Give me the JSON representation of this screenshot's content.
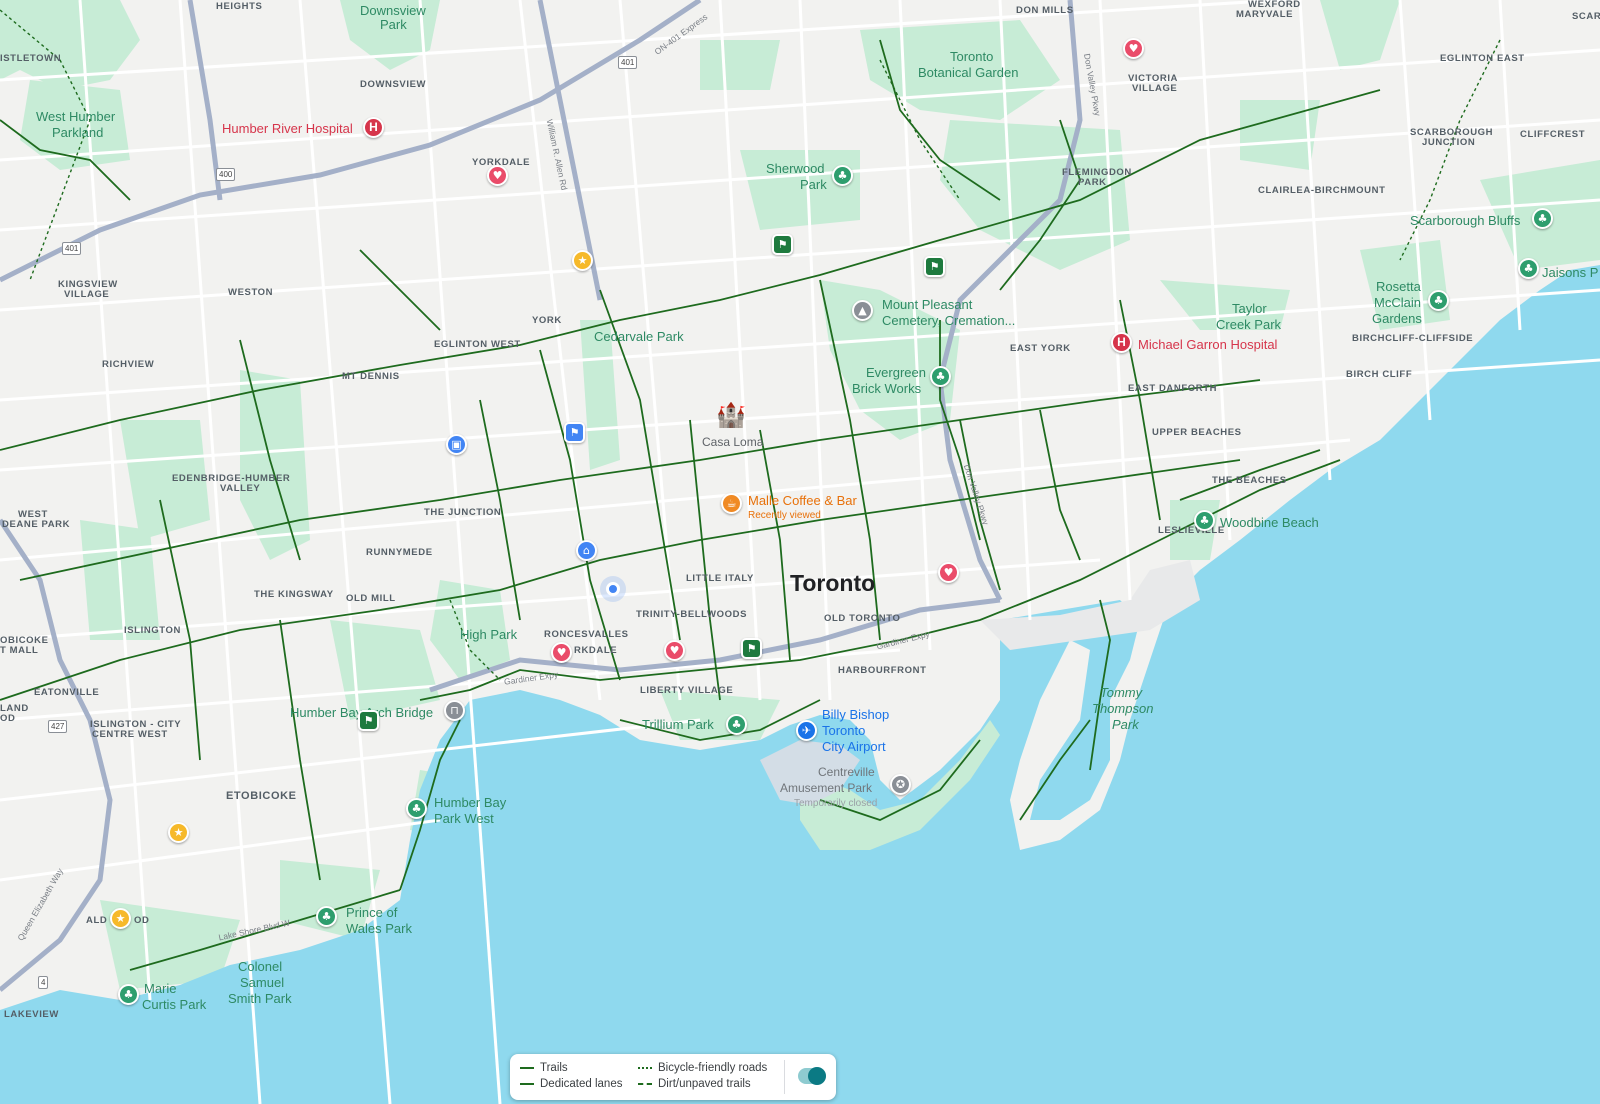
{
  "map": {
    "colors": {
      "land": "#f2f2f0",
      "water": "#8fd9ee",
      "park": "#c7ecd6",
      "trail": "#1e6b1e",
      "road": "#ffffff",
      "highway": "#9aa8c2"
    },
    "city_label": "Toronto",
    "neighbourhoods": [
      "HEIGHTS",
      "DON MILLS",
      "WEXFORD",
      "MARYVALE",
      "ISTLETOWN",
      "DOWNSVIEW",
      "EGLINTON EAST",
      "VICTORIA",
      "VILLAGE",
      "SCARBOROUGH",
      "JUNCTION",
      "CLIFFCREST",
      "YORKDALE",
      "FLEMINGDON",
      "PARK",
      "CLAIRLEA-BIRCHMOUNT",
      "KINGSVIEW",
      "VILLAGE",
      "WESTON",
      "YORK",
      "EGLINTON WEST",
      "EAST YORK",
      "BIRCHCLIFF-CLIFFSIDE",
      "RICHVIEW",
      "MT DENNIS",
      "BIRCH CLIFF",
      "EAST DANFORTH",
      "UPPER BEACHES",
      "EDENBRIDGE-HUMBER",
      "VALLEY",
      "THE JUNCTION",
      "THE BEACHES",
      "WEST",
      "DEANE PARK",
      "RUNNYMEDE",
      "LESLIEVILLE",
      "LITTLE ITALY",
      "THE KINGSWAY",
      "OLD MILL",
      "TRINITY-BELLWOODS",
      "OLD TORONTO",
      "OBICOKE",
      "T MALL",
      "ISLINGTON",
      "RONCESVALLES",
      "RKDALE",
      "HARBOURFRONT",
      "LIBERTY VILLAGE",
      "EATONVILLE",
      "LAND",
      "OD",
      "ISLINGTON - CITY",
      "CENTRE WEST",
      "ETOBICOKE",
      "ALD",
      "OD",
      "LAKEVIEW",
      "SCAR"
    ],
    "parks": [
      "Downsview",
      "Park",
      "Toronto",
      "Botanical Garden",
      "West Humber",
      "Parkland",
      "Sherwood",
      "Park",
      "Scarborough Bluffs",
      "Jaisons P",
      "Mount Pleasant",
      "Cemetery, Cremation...",
      "Taylor",
      "Creek Park",
      "Rosetta",
      "McClain",
      "Gardens",
      "Cedarvale Park",
      "Evergreen",
      "Brick Works",
      "Woodbine Beach",
      "High Park",
      "Humber Bay Arch Bridge",
      "Trillium Park",
      "Humber Bay",
      "Park West",
      "Prince of",
      "Wales Park",
      "Colonel",
      "Samuel",
      "Smith Park",
      "Marie",
      "Curtis Park"
    ],
    "hospitals": [
      "Humber River Hospital",
      "Michael Garron Hospital"
    ],
    "landmark": "Casa Loma",
    "cafe": {
      "name": "Malle Coffee & Bar",
      "note": "Recently viewed"
    },
    "airport": {
      "line1": "Billy Bishop",
      "line2": "Toronto",
      "line3": "City Airport"
    },
    "amusement": {
      "line1": "Centreville",
      "line2": "Amusement Park",
      "note": "Temporarily closed"
    },
    "tommy": {
      "line1": "Tommy",
      "line2": "Thompson",
      "line3": "Park"
    },
    "roads": [
      "ON-401 Express",
      "401",
      "400",
      "401",
      "William R. Allen Rd",
      "Don Valley Pkwy",
      "Gardiner Expy",
      "Gardiner Expy",
      "Lake Shore Blvd W",
      "Queen Elizabeth Way",
      "427",
      "4",
      "Don Valley Pkwy"
    ]
  },
  "legend": {
    "trails": "Trails",
    "dedicated_lanes": "Dedicated lanes",
    "bicycle_friendly": "Bicycle-friendly roads",
    "dirt_trails": "Dirt/unpaved trails",
    "toggle_on": "true"
  }
}
